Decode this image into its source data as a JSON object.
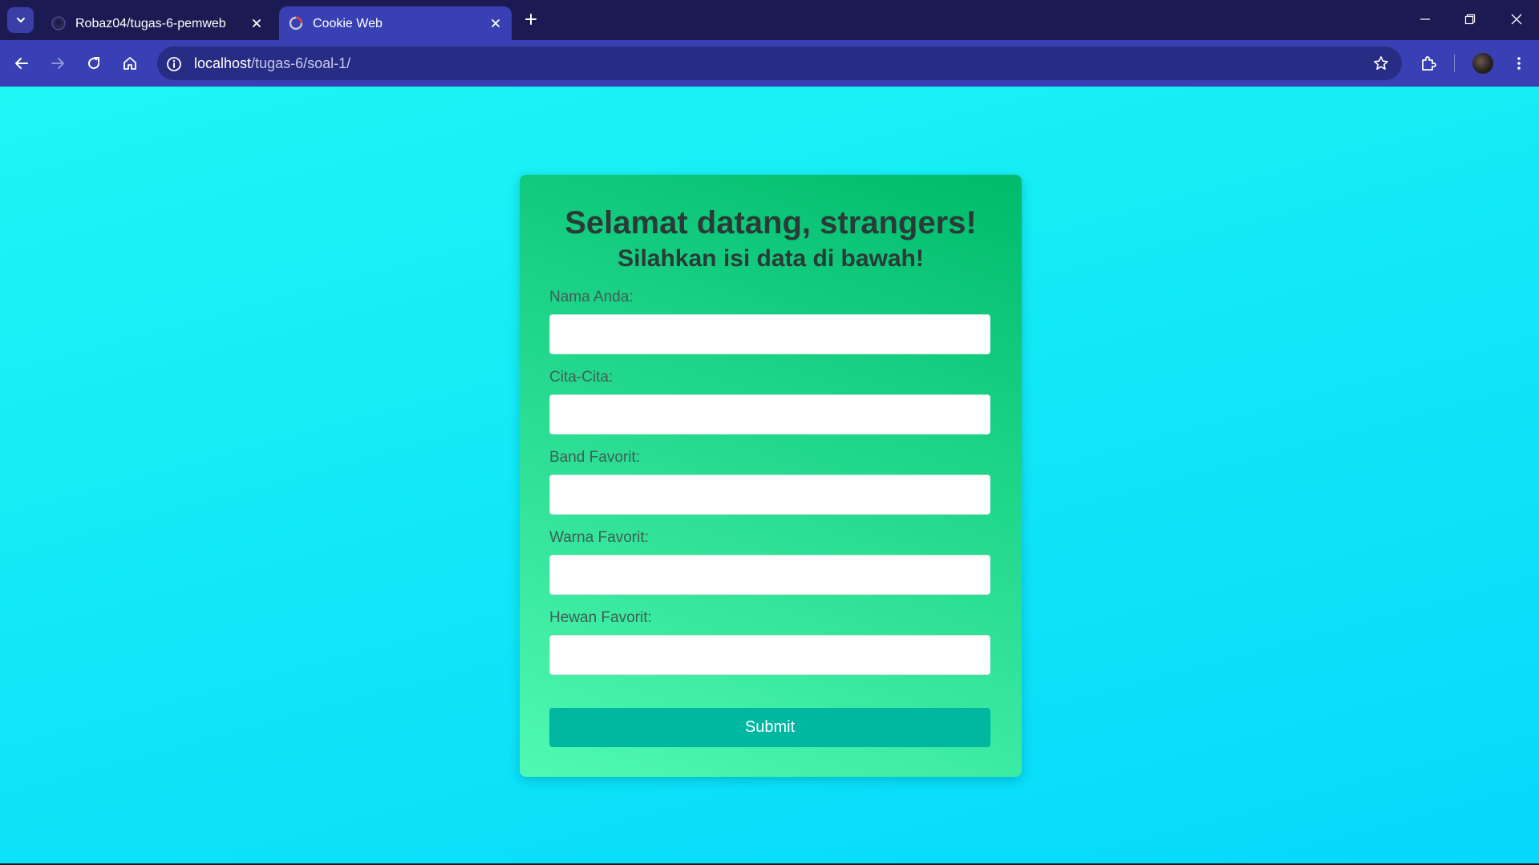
{
  "browser": {
    "tabs": [
      {
        "label": "Robaz04/tugas-6-pemweb",
        "active": false,
        "icon": "github-icon"
      },
      {
        "label": "Cookie Web",
        "active": true,
        "icon": "globe-icon"
      }
    ],
    "address": {
      "host": "localhost",
      "path": "/tugas-6/soal-1/"
    }
  },
  "page": {
    "title": "Selamat datang, strangers!",
    "subtitle": "Silahkan isi data di bawah!",
    "fields": [
      {
        "label": "Nama Anda:",
        "value": ""
      },
      {
        "label": "Cita-Cita:",
        "value": ""
      },
      {
        "label": "Band Favorit:",
        "value": ""
      },
      {
        "label": "Warna Favorit:",
        "value": ""
      },
      {
        "label": "Hewan Favorit:",
        "value": ""
      }
    ],
    "submit_label": "Submit"
  },
  "colors": {
    "background": "#11e9f7",
    "card_top": "#00bb6c",
    "card_bottom": "#50f9b2",
    "submit_button": "#00b8a1",
    "heading_text": "#2a3a36",
    "browser_frame": "#1c1a52",
    "browser_toolbar": "#3840b3"
  }
}
